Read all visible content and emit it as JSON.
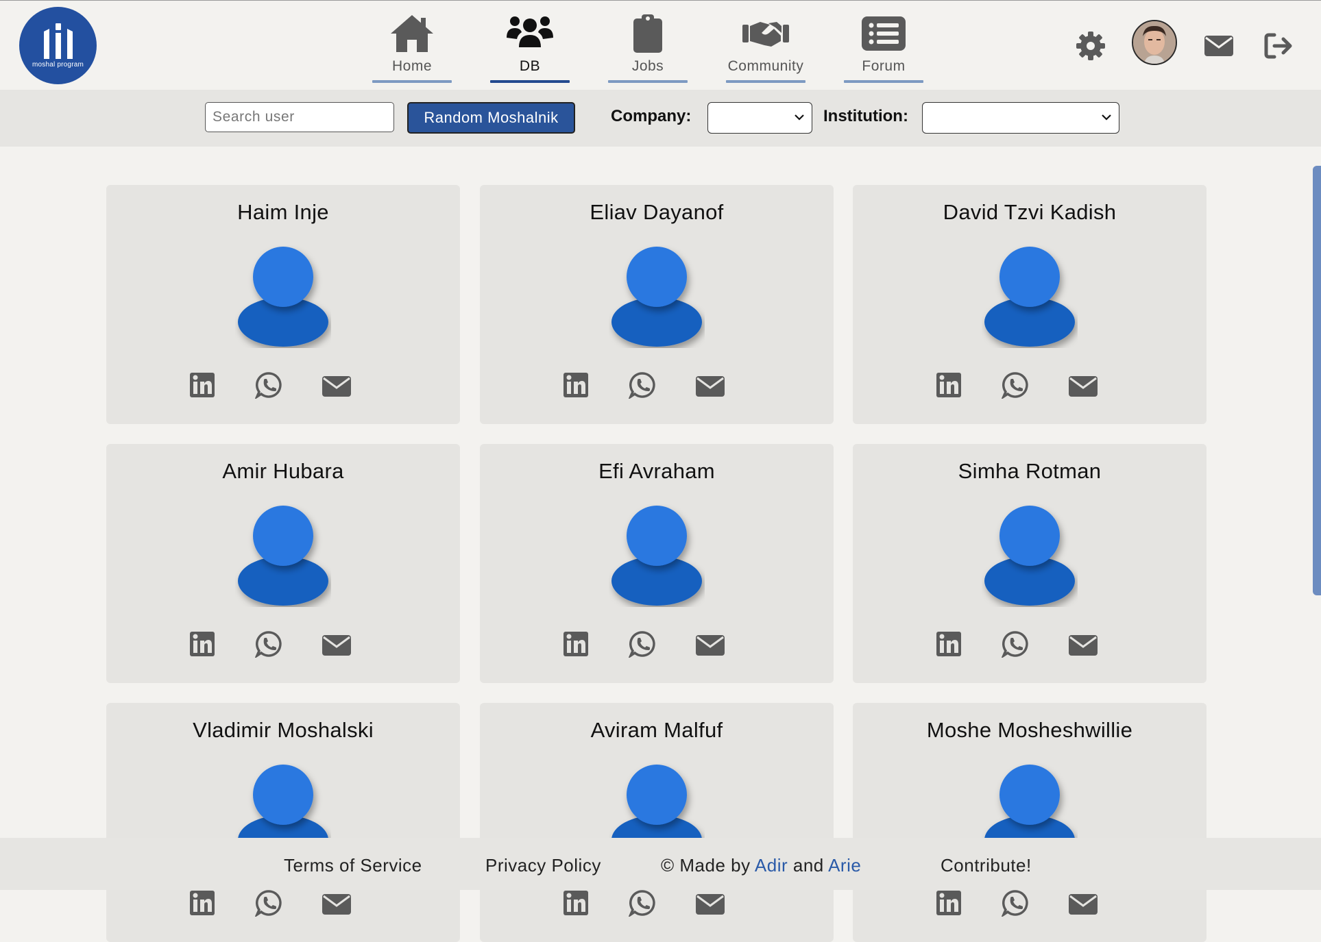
{
  "brand": {
    "logo_text": "moshal program"
  },
  "nav": {
    "items": [
      {
        "label": "Home",
        "icon": "home-icon"
      },
      {
        "label": "DB",
        "icon": "users-icon",
        "active": true
      },
      {
        "label": "Jobs",
        "icon": "clipboard-icon"
      },
      {
        "label": "Community",
        "icon": "handshake-icon"
      },
      {
        "label": "Forum",
        "icon": "list-icon"
      }
    ]
  },
  "header_actions": [
    "gear-icon",
    "avatar",
    "envelope-icon",
    "logout-icon"
  ],
  "filters": {
    "search_placeholder": "Search user",
    "search_value": "",
    "random_button": "Random Moshalnik",
    "company_label": "Company:",
    "company_value": "",
    "institution_label": "Institution:",
    "institution_value": ""
  },
  "users": [
    {
      "name": "Haim Inje"
    },
    {
      "name": "Eliav Dayanof"
    },
    {
      "name": "David Tzvi Kadish"
    },
    {
      "name": "Amir Hubara"
    },
    {
      "name": "Efi Avraham"
    },
    {
      "name": "Simha Rotman"
    },
    {
      "name": "Vladimir Moshalski"
    },
    {
      "name": "Aviram Malfuf"
    },
    {
      "name": "Moshe Mosheshwillie"
    }
  ],
  "card_icons": [
    "linkedin-icon",
    "whatsapp-icon",
    "envelope-icon"
  ],
  "footer": {
    "terms": "Terms of Service",
    "privacy": "Privacy Policy",
    "made_by_prefix": "© Made by ",
    "author1": "Adir",
    "and": " and ",
    "author2": "Arie",
    "contribute": "Contribute!"
  },
  "colors": {
    "accent": "#2a549a",
    "nav_underline": "#7d9ac2",
    "nav_underline_active": "#234a8f",
    "avatar_head": "#2a78e0",
    "avatar_body": "#1760bf",
    "card_bg": "#e5e4e1",
    "page_bg": "#f3f2ef"
  }
}
